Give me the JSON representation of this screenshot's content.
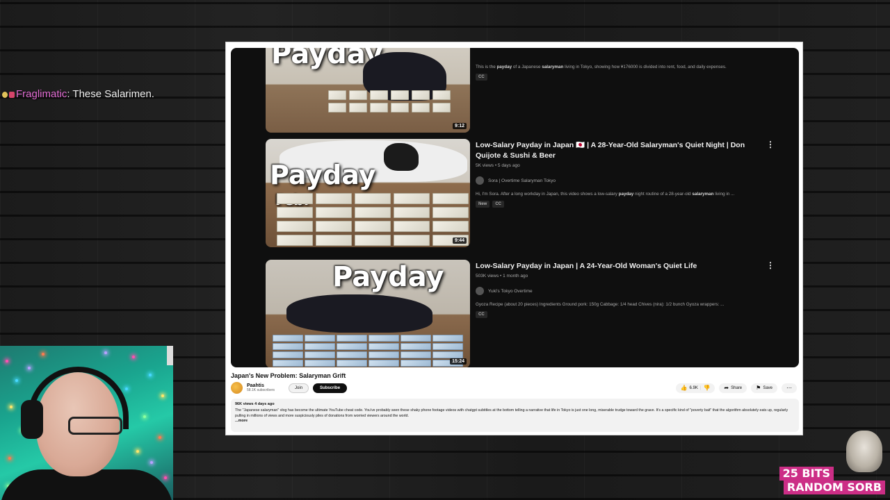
{
  "chat": {
    "username": "Fraglimatic",
    "message": ": These Salarimen."
  },
  "videos": [
    {
      "thumb_text": "Payday",
      "thumb_subtext": "",
      "duration": "9:12",
      "title": "",
      "meta": "",
      "channel": "",
      "desc_pre": "This is the ",
      "desc_kw1": "payday",
      "desc_mid": " of a Japanese ",
      "desc_kw2": "salaryman",
      "desc_post": " living in Tokyo, showing how ¥176000 is divided into rent, food, and daily expenses.",
      "tags": [
        "CC"
      ]
    },
    {
      "thumb_text": "Payday",
      "thumb_subtext": "Feb.",
      "duration": "9:44",
      "title": "Low-Salary Payday in Japan 🇯🇵 | A 28-Year-Old Salaryman's Quiet Night | Don Quijote & Sushi & Beer",
      "meta": "5K views • 5 days ago",
      "channel": "Sora | Overtime Salaryman Tokyo",
      "desc_pre": "Hi, I'm Sora. After a long workday in Japan, this video shows a low-salary ",
      "desc_kw1": "payday",
      "desc_mid": " night routine of a 28-year-old ",
      "desc_kw2": "salaryman",
      "desc_post": " living in ...",
      "tags": [
        "New",
        "CC"
      ]
    },
    {
      "thumb_text": "Payday",
      "thumb_subtext": "",
      "duration": "15:24",
      "title": "Low-Salary Payday in Japan | A 24-Year-Old Woman's Quiet Life",
      "meta": "503K views • 1 month ago",
      "channel": "Yuki's Tokyo Overtime",
      "desc_pre": "Gyoza Recipe (about 20 pieces) Ingredients Ground pork: 150g Cabbage: 1/4 head Chives (nira): 1/2 bunch Gyoza wrappers: ...",
      "desc_kw1": "",
      "desc_mid": "",
      "desc_kw2": "",
      "desc_post": "",
      "tags": [
        "CC"
      ]
    }
  ],
  "watch": {
    "title": "Japan's New Problem: Salaryman Grift",
    "channel_name": "Paahtis",
    "subscribers": "58.1K subscribers",
    "join_label": "Join",
    "subscribe_label": "Subscribe",
    "likes": "6.9K",
    "share_label": "Share",
    "save_label": "Save",
    "desc_meta": "96K views  4 days ago",
    "description": "The \"Japanese salaryman\" vlog has become the ultimate YouTube cheat code. You've probably seen these shaky phone footage videos with chatgpt subtitles at the bottom telling a narrative that life in Tokyo is just one long, miserable trudge toward the grave. It's a specific kind of \"poverty bait\" that the algorithm absolutely eats up, regularly pulling in millions of views and more suspiciously piles of donations from worried viewers around the world.",
    "more_label": "...more"
  },
  "alert": {
    "line1": "25 BITS",
    "line2": "RANDOM SORB"
  },
  "colors": {
    "youtube_dark": "#0f0f0f",
    "alert_pink": "#cc2e86",
    "chat_user": "#e26cd3"
  }
}
